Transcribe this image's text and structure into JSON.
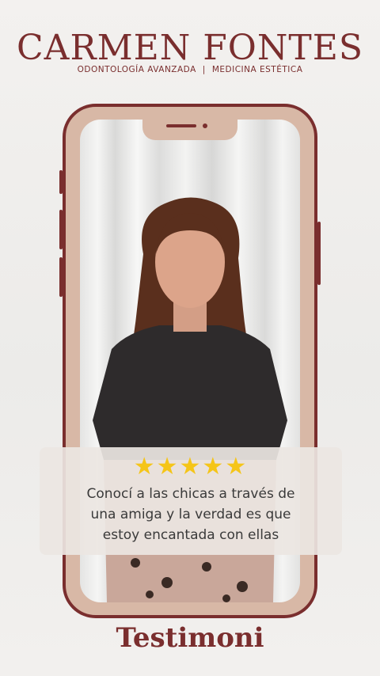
{
  "brand": {
    "name": "CARMEN FONTES",
    "tagline_left": "ODONTOLOGÍA AVANZADA",
    "separator": "|",
    "tagline_right": "MEDICINA ESTÉTICA"
  },
  "review": {
    "stars": "★★★★★",
    "rating": 5,
    "text_line1": "Conocí a las chicas a través de",
    "text_line2": "una amiga y la verdad es que",
    "text_line3": "estoy encantada con ellas"
  },
  "footer": {
    "title": "Testimoni"
  },
  "colors": {
    "brand": "#7a2e2e",
    "phone_frame": "#d8b8a6",
    "star": "#f5c518"
  }
}
